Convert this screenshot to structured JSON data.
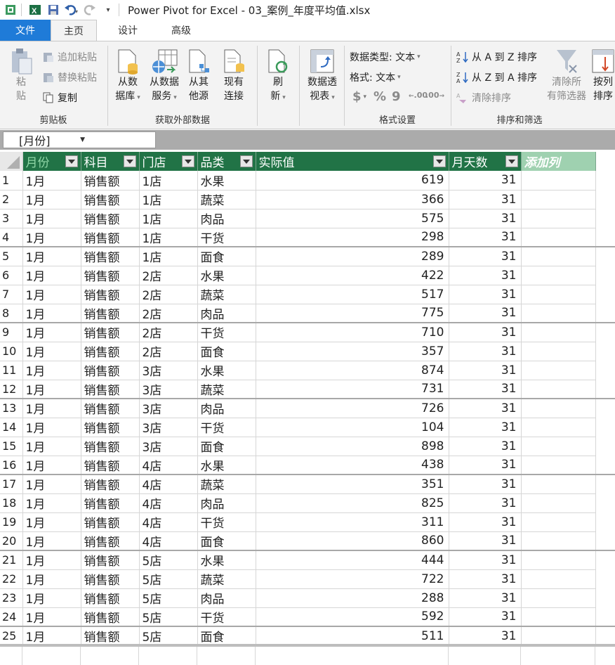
{
  "title": "Power Pivot for Excel - 03_案例_年度平均值.xlsx",
  "tabs": [
    "文件",
    "主页",
    "设计",
    "高级"
  ],
  "ribbon": {
    "clipboard": {
      "paste": "粘\n贴",
      "paste_line1": "粘",
      "paste_line2": "贴",
      "append_paste": "追加粘贴",
      "replace_paste": "替换粘贴",
      "copy": "复制",
      "label": "剪贴板"
    },
    "external": {
      "from_db_l1": "从数",
      "from_db_l2": "据库",
      "from_service_l1": "从数据",
      "from_service_l2": "服务",
      "from_other_l1": "从其",
      "from_other_l2": "他源",
      "existing_l1": "现有",
      "existing_l2": "连接",
      "label": "获取外部数据"
    },
    "refresh": {
      "l1": "刷",
      "l2": "新"
    },
    "pivot": {
      "l1": "数据透",
      "l2": "视表"
    },
    "format": {
      "data_type": "数据类型: 文本",
      "format": "格式: 文本",
      "currency": "$",
      "percent": "%",
      "comma": "9",
      "inc_dec": ".00",
      "dec_dec": ".00",
      "label": "格式设置"
    },
    "sort": {
      "a_to_z": "从 A 到 Z 排序",
      "z_to_a": "从 Z 到 A 排序",
      "clear_sort": "清除排序",
      "clear_filters_l1": "清除所",
      "clear_filters_l2": "有筛选器",
      "sort_by_col_l1": "按列",
      "sort_by_col_l2": "排序",
      "label": "排序和筛选"
    }
  },
  "column_selector": "[月份]",
  "columns": [
    "月份",
    "科目",
    "门店",
    "品类",
    "实际值",
    "月天数",
    "添加列"
  ],
  "rows": [
    [
      "1",
      "1月",
      "销售额",
      "1店",
      "水果",
      "619",
      "31"
    ],
    [
      "2",
      "1月",
      "销售额",
      "1店",
      "蔬菜",
      "366",
      "31"
    ],
    [
      "3",
      "1月",
      "销售额",
      "1店",
      "肉品",
      "575",
      "31"
    ],
    [
      "4",
      "1月",
      "销售额",
      "1店",
      "干货",
      "298",
      "31"
    ],
    [
      "5",
      "1月",
      "销售额",
      "1店",
      "面食",
      "289",
      "31"
    ],
    [
      "6",
      "1月",
      "销售额",
      "2店",
      "水果",
      "422",
      "31"
    ],
    [
      "7",
      "1月",
      "销售额",
      "2店",
      "蔬菜",
      "517",
      "31"
    ],
    [
      "8",
      "1月",
      "销售额",
      "2店",
      "肉品",
      "775",
      "31"
    ],
    [
      "9",
      "1月",
      "销售额",
      "2店",
      "干货",
      "710",
      "31"
    ],
    [
      "10",
      "1月",
      "销售额",
      "2店",
      "面食",
      "357",
      "31"
    ],
    [
      "11",
      "1月",
      "销售额",
      "3店",
      "水果",
      "874",
      "31"
    ],
    [
      "12",
      "1月",
      "销售额",
      "3店",
      "蔬菜",
      "731",
      "31"
    ],
    [
      "13",
      "1月",
      "销售额",
      "3店",
      "肉品",
      "726",
      "31"
    ],
    [
      "14",
      "1月",
      "销售额",
      "3店",
      "干货",
      "104",
      "31"
    ],
    [
      "15",
      "1月",
      "销售额",
      "3店",
      "面食",
      "898",
      "31"
    ],
    [
      "16",
      "1月",
      "销售额",
      "4店",
      "水果",
      "438",
      "31"
    ],
    [
      "17",
      "1月",
      "销售额",
      "4店",
      "蔬菜",
      "351",
      "31"
    ],
    [
      "18",
      "1月",
      "销售额",
      "4店",
      "肉品",
      "825",
      "31"
    ],
    [
      "19",
      "1月",
      "销售额",
      "4店",
      "干货",
      "311",
      "31"
    ],
    [
      "20",
      "1月",
      "销售额",
      "4店",
      "面食",
      "860",
      "31"
    ],
    [
      "21",
      "1月",
      "销售额",
      "5店",
      "水果",
      "444",
      "31"
    ],
    [
      "22",
      "1月",
      "销售额",
      "5店",
      "蔬菜",
      "722",
      "31"
    ],
    [
      "23",
      "1月",
      "销售额",
      "5店",
      "肉品",
      "288",
      "31"
    ],
    [
      "24",
      "1月",
      "销售额",
      "5店",
      "干货",
      "592",
      "31"
    ],
    [
      "25",
      "1月",
      "销售额",
      "5店",
      "面食",
      "511",
      "31"
    ]
  ],
  "colors": {
    "header": "#217346",
    "add_column": "#9fd1b0",
    "file_tab": "#1f7bd8"
  }
}
